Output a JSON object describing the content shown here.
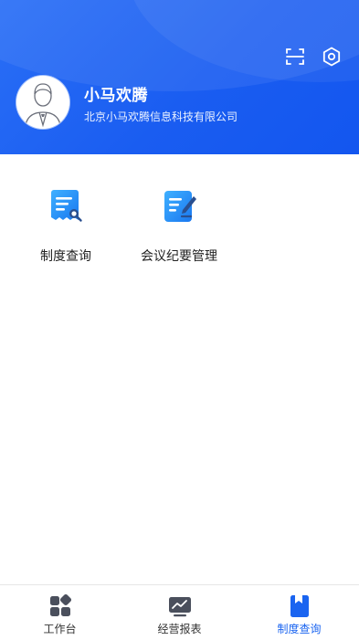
{
  "header": {
    "user_name": "小马欢腾",
    "company": "北京小马欢腾信息科技有限公司",
    "actions": [
      {
        "icon": "scan-icon"
      },
      {
        "icon": "settings-icon"
      }
    ]
  },
  "grid": [
    {
      "label": "制度查询",
      "icon": "document-search-icon"
    },
    {
      "label": "会议纪要管理",
      "icon": "note-edit-icon"
    }
  ],
  "tabbar": {
    "tabs": [
      {
        "label": "工作台",
        "icon": "workbench-icon",
        "active": false
      },
      {
        "label": "经营报表",
        "icon": "chart-report-icon",
        "active": false
      },
      {
        "label": "制度查询",
        "icon": "bookmark-icon",
        "active": true
      }
    ]
  },
  "colors": {
    "header_bg": "#1a5df1",
    "accent": "#1a64f0",
    "icon_blue_start": "#36a2ff",
    "icon_blue_end": "#1a75f0"
  }
}
